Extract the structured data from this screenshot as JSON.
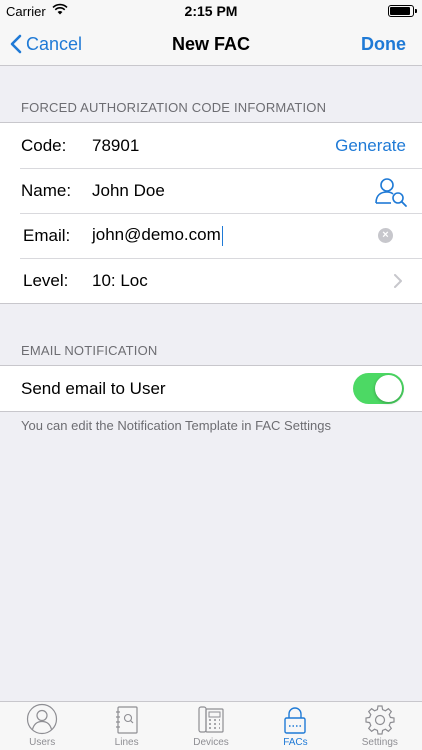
{
  "status_bar": {
    "carrier": "Carrier",
    "time": "2:15 PM"
  },
  "nav": {
    "back_label": "Cancel",
    "title": "New FAC",
    "done_label": "Done"
  },
  "fac_info": {
    "header": "FORCED AUTHORIZATION CODE INFORMATION",
    "code_label": "Code:",
    "code_value": "78901",
    "generate_label": "Generate",
    "name_label": "Name:",
    "name_value": "John Doe",
    "email_label": "Email:",
    "email_value": "john@demo.com",
    "level_label": "Level:",
    "level_value": "10: Loc"
  },
  "email_notification": {
    "header": "EMAIL NOTIFICATION",
    "send_label": "Send email to User",
    "send_enabled": true,
    "note": "You can edit the Notification Template in FAC Settings"
  },
  "tabs": [
    {
      "label": "Users",
      "icon": "user-icon",
      "active": false
    },
    {
      "label": "Lines",
      "icon": "address-book-icon",
      "active": false
    },
    {
      "label": "Devices",
      "icon": "phone-icon",
      "active": false
    },
    {
      "label": "FACs",
      "icon": "lock-icon",
      "active": true
    },
    {
      "label": "Settings",
      "icon": "gear-icon",
      "active": false
    }
  ],
  "colors": {
    "accent": "#1f7ad6",
    "toggle_on": "#4cd964",
    "background": "#efeff4"
  }
}
